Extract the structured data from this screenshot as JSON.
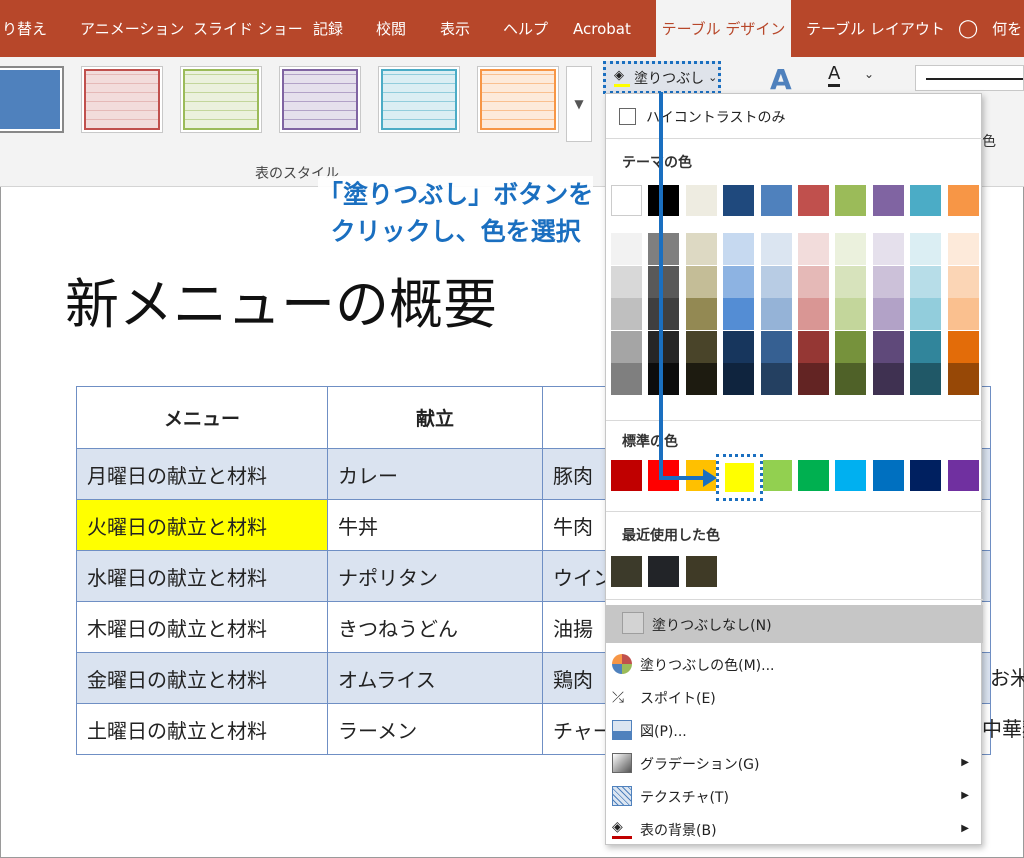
{
  "tabs": [
    "り替え",
    "アニメーション",
    "スライド ショー",
    "記録",
    "校閲",
    "表示",
    "ヘルプ",
    "Acrobat",
    "テーブル デザイン",
    "テーブル レイアウト",
    "何を"
  ],
  "ribbon": {
    "group_label": "表のスタイル",
    "fill_button_label": "塗りつぶし",
    "right_partial_label": "色"
  },
  "callout": {
    "line1": "「塗りつぶし」ボタンを",
    "line2": "クリックし、色を選択"
  },
  "slide": {
    "title": "新メニューの概要",
    "table": {
      "headers": [
        "メニュー",
        "献立",
        ""
      ],
      "rows": [
        [
          "月曜日の献立と材料",
          "カレー",
          "豚肉"
        ],
        [
          "火曜日の献立と材料",
          "牛丼",
          "牛肉"
        ],
        [
          "水曜日の献立と材料",
          "ナポリタン",
          "ウイン"
        ],
        [
          "木曜日の献立と材料",
          "きつねうどん",
          "油揚"
        ],
        [
          "金曜日の献立と材料",
          "オムライス",
          "鶏肉"
        ],
        [
          "土曜日の献立と材料",
          "ラーメン",
          "チャー"
        ]
      ],
      "right_overflow": [
        "お米",
        "中華麺"
      ]
    }
  },
  "dropdown": {
    "high_contrast_label": "ハイコントラストのみ",
    "theme_colors_label": "テーマの色",
    "standard_colors_label": "標準の色",
    "recent_colors_label": "最近使用した色",
    "no_fill_label": "塗りつぶしなし(N)",
    "more_colors_label": "塗りつぶしの色(M)...",
    "eyedropper_label": "スポイト(E)",
    "picture_label": "図(P)...",
    "gradient_label": "グラデーション(G)",
    "texture_label": "テクスチャ(T)",
    "table_background_label": "表の背景(B)",
    "theme_colors": [
      "#ffffff",
      "#000000",
      "#eeece1",
      "#1f497d",
      "#4f81bd",
      "#c0504d",
      "#9bbb59",
      "#8064a2",
      "#4bacc6",
      "#f79646"
    ],
    "theme_shades": [
      [
        "#f2f2f2",
        "#d8d8d8",
        "#bfbfbf",
        "#a5a5a5",
        "#7f7f7f"
      ],
      [
        "#7f7f7f",
        "#595959",
        "#3f3f3f",
        "#262626",
        "#0c0c0c"
      ],
      [
        "#ddd9c3",
        "#c4bd97",
        "#938953",
        "#494429",
        "#1d1b10"
      ],
      [
        "#c6d9f0",
        "#8db3e2",
        "#548dd4",
        "#17365d",
        "#0f243e"
      ],
      [
        "#dbe5f1",
        "#b8cce4",
        "#95b3d7",
        "#366092",
        "#244061"
      ],
      [
        "#f2dcdb",
        "#e5b9b7",
        "#d99694",
        "#953734",
        "#632423"
      ],
      [
        "#ebf1dd",
        "#d7e3bc",
        "#c3d69b",
        "#76923c",
        "#4f6128"
      ],
      [
        "#e5e0ec",
        "#ccc1d9",
        "#b2a2c7",
        "#5f497a",
        "#3f3151"
      ],
      [
        "#dbeef3",
        "#b7dde8",
        "#92cddc",
        "#31859b",
        "#205867"
      ],
      [
        "#fdeada",
        "#fbd5b5",
        "#fac08f",
        "#e36c09",
        "#974806"
      ]
    ],
    "standard_colors": [
      "#c00000",
      "#ff0000",
      "#ffc000",
      "#ffff00",
      "#92d050",
      "#00b050",
      "#00b0f0",
      "#0070c0",
      "#002060",
      "#7030a0"
    ],
    "recent_colors": [
      "#3c3a2a",
      "#222428",
      "#3f3a26"
    ],
    "accent_color": "#1a6fc0",
    "tab_color": "#b7472a"
  }
}
